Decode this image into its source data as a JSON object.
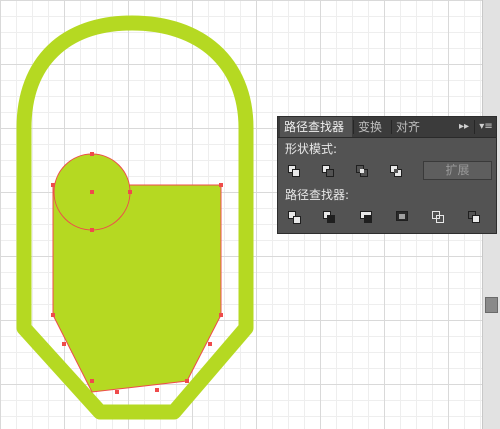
{
  "colors": {
    "shape_fill": "#b5d922",
    "selection": "#ef4b4b",
    "panel_bg": "#535353",
    "tab_bg": "#3b3b3b"
  },
  "canvas": {
    "outer_shape": "rounded capsule outline",
    "inner_shape": "filled green body with circle overlapping top-left"
  },
  "panel": {
    "tabs": [
      {
        "label": "路径查找器",
        "active": true
      },
      {
        "label": "变换",
        "active": false
      },
      {
        "label": "对齐",
        "active": false
      }
    ],
    "collapse_icon": "double-chevron-right-icon",
    "menu_icon": "panel-menu-icon",
    "shape_modes_label": "形状模式:",
    "shape_modes": [
      {
        "name": "unite-icon"
      },
      {
        "name": "minus-front-icon"
      },
      {
        "name": "intersect-icon"
      },
      {
        "name": "exclude-icon"
      }
    ],
    "expand_label": "扩展",
    "pathfinders_label": "路径查找器:",
    "pathfinders": [
      {
        "name": "divide-icon"
      },
      {
        "name": "trim-icon"
      },
      {
        "name": "merge-icon"
      },
      {
        "name": "crop-icon"
      },
      {
        "name": "outline-icon"
      },
      {
        "name": "minus-back-icon"
      }
    ]
  }
}
